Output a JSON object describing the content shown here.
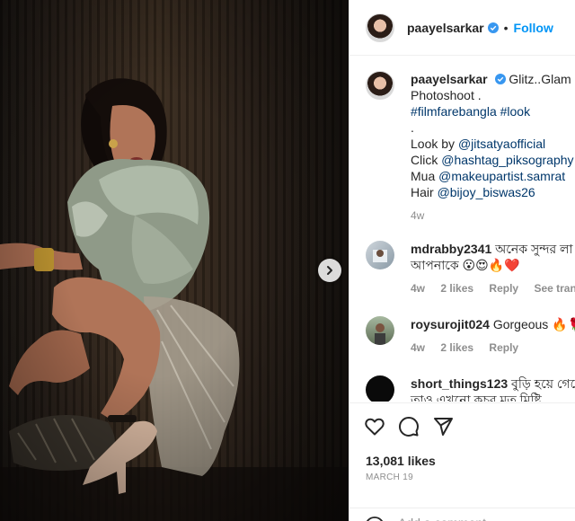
{
  "post": {
    "author": "paayelsarkar",
    "follow_label": "Follow",
    "dot": "•"
  },
  "caption": {
    "username": "paayelsarkar",
    "line1": "Glitz..Glam and",
    "line2": "Photoshoot .",
    "hashtags": "#filmfarebangla #look",
    "dot_line": ".",
    "look_prefix": "Look by ",
    "look_tag": "@jitsatyaofficial",
    "click_prefix": "Click ",
    "click_tag": "@hashtag_piksography",
    "mua_prefix": "Mua ",
    "mua_tag": "@makeupartist.samrat",
    "hair_prefix": "Hair ",
    "hair_tag": "@bijoy_biswas26",
    "age": "4w"
  },
  "comments": [
    {
      "username": "mdrabby2341",
      "text_line1": "অনেক সুন্দর লা",
      "text_line2": "আপনাকে 😮😍🔥❤️",
      "age": "4w",
      "likes": "2 likes",
      "reply": "Reply",
      "see_translation": "See translation"
    },
    {
      "username": "roysurojit024",
      "text_line1": "Gorgeous 🔥🌹",
      "age": "4w",
      "likes": "2 likes",
      "reply": "Reply"
    },
    {
      "username": "short_things123",
      "text_line1": "বুড়ি হয়ে গেছে",
      "text_line2": "তাও এখনো কচুর মত মিষ্টি"
    }
  ],
  "actions": {
    "likes": "13,081 likes",
    "date": "MARCH 19",
    "comment_placeholder": "Add a comment..."
  },
  "icons": {
    "like": "heart-icon",
    "comment": "comment-bubble-icon",
    "share": "paper-plane-icon",
    "next": "chevron-right-icon",
    "verified": "verified-badge-icon",
    "emoji": "emoji-smile-icon"
  },
  "colors": {
    "link": "#0095f6",
    "tag": "#00376b",
    "verified": "#3897f0",
    "muted": "#8e8e8e"
  }
}
